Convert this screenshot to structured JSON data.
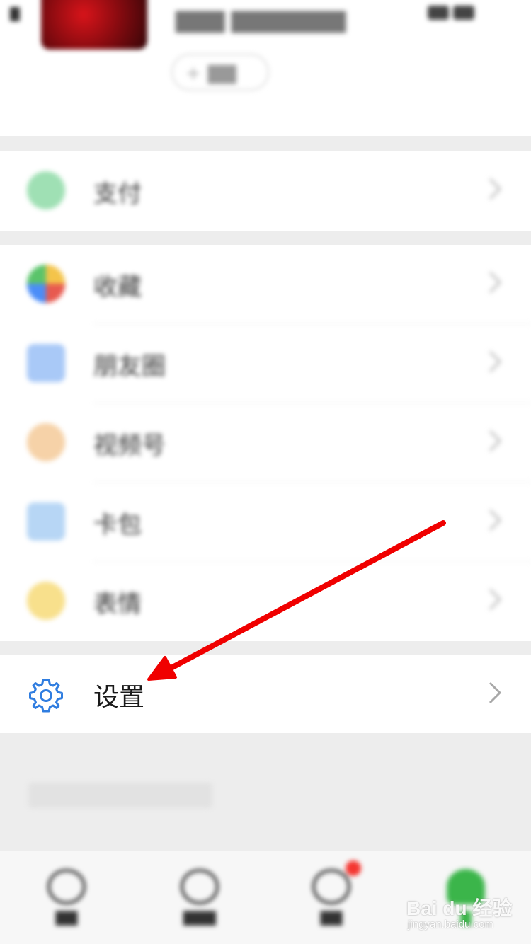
{
  "menu": {
    "items": [
      {
        "label": "支付",
        "icon": "pay-icon"
      },
      {
        "label": "收藏",
        "icon": "favorites-icon"
      },
      {
        "label": "朋友圈",
        "icon": "moments-icon"
      },
      {
        "label": "视频号",
        "icon": "channels-icon"
      },
      {
        "label": "卡包",
        "icon": "card-wallet-icon"
      },
      {
        "label": "表情",
        "icon": "sticker-icon"
      }
    ],
    "settings_label": "设置",
    "settings_icon": "gear-icon",
    "settings_color": "#2f7de0"
  },
  "annotation": {
    "arrow_color": "#f00000"
  },
  "watermark": {
    "brand": "Bai du 经验",
    "url": "jingyan.baidu.com"
  }
}
